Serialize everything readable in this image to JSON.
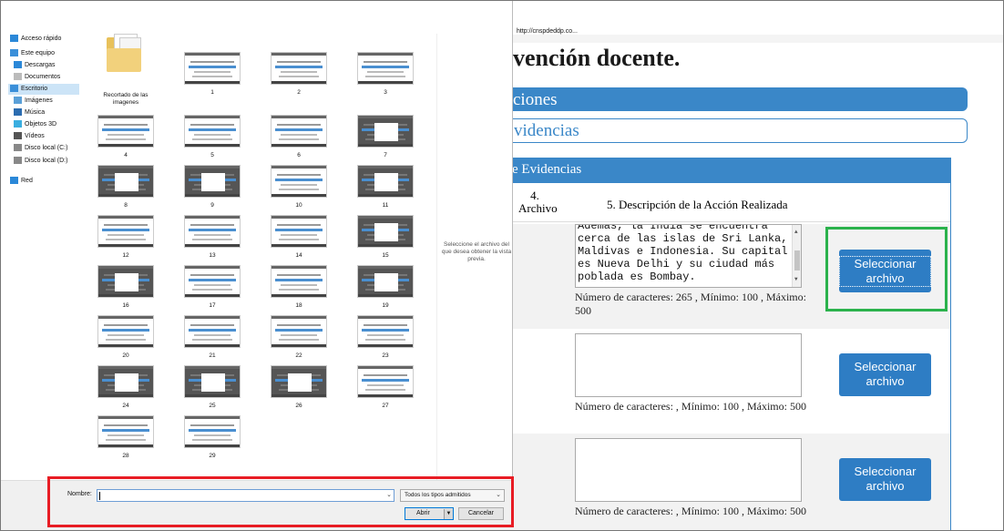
{
  "browser": {
    "url": "http://cnspdeddp.co...",
    "heading": "vención docente.",
    "bar_solid": "ciones",
    "bar_outline": "videncias",
    "table": {
      "title": "e Evidencias",
      "col4_line1": "4.",
      "col4_line2": "Archivo",
      "col5": "5. Descripción de la Acción Realizada",
      "rows": [
        {
          "text_lines": [
            "Además, la India se encuentra",
            "cerca de las islas de Sri Lanka,",
            "Maldivas e Indonesia. Su capital",
            "es Nueva Delhi y su ciudad más",
            "poblada es Bombay."
          ],
          "count": "Número de caracteres: 265 , Mínimo: 100 , Máximo: 500",
          "button": "Seleccionar archivo"
        },
        {
          "text_lines": [],
          "count": "Número de caracteres: , Mínimo: 100 , Máximo: 500",
          "button": "Seleccionar archivo"
        },
        {
          "text_lines": [],
          "count": "Número de caracteres: , Mínimo: 100 , Máximo: 500",
          "button": "Seleccionar archivo"
        }
      ]
    }
  },
  "dialog": {
    "nav": [
      {
        "label": "Acceso rápido",
        "icon": "star-icon",
        "color": "#2b88d8"
      },
      {
        "label": "Este equipo",
        "icon": "computer-icon",
        "color": "#3a8fd9"
      },
      {
        "label": "Descargas",
        "icon": "download-icon",
        "color": "#2b88d8"
      },
      {
        "label": "Documentos",
        "icon": "document-icon",
        "color": "#bbbbbb"
      },
      {
        "label": "Escritorio",
        "icon": "desktop-icon",
        "color": "#3a8fd9"
      },
      {
        "label": "Imágenes",
        "icon": "image-icon",
        "color": "#5aa0d8"
      },
      {
        "label": "Música",
        "icon": "music-icon",
        "color": "#2b6cb0"
      },
      {
        "label": "Objetos 3D",
        "icon": "cube-icon",
        "color": "#3aaee0"
      },
      {
        "label": "Vídeos",
        "icon": "video-icon",
        "color": "#555555"
      },
      {
        "label": "Disco local (C:)",
        "icon": "drive-icon",
        "color": "#888888"
      },
      {
        "label": "Disco local (D:)",
        "icon": "drive-icon",
        "color": "#888888"
      },
      {
        "label": "Red",
        "icon": "network-icon",
        "color": "#2b88d8"
      }
    ],
    "files": [
      {
        "label": "Recortado de las imagenes",
        "kind": "folder"
      },
      {
        "label": "1",
        "kind": "light"
      },
      {
        "label": "2",
        "kind": "light"
      },
      {
        "label": "3",
        "kind": "light"
      },
      {
        "label": "4",
        "kind": "light"
      },
      {
        "label": "5",
        "kind": "light"
      },
      {
        "label": "6",
        "kind": "light"
      },
      {
        "label": "7",
        "kind": "dark"
      },
      {
        "label": "8",
        "kind": "dark"
      },
      {
        "label": "9",
        "kind": "dark"
      },
      {
        "label": "10",
        "kind": "light"
      },
      {
        "label": "11",
        "kind": "dark"
      },
      {
        "label": "12",
        "kind": "light"
      },
      {
        "label": "13",
        "kind": "light"
      },
      {
        "label": "14",
        "kind": "light"
      },
      {
        "label": "15",
        "kind": "dark"
      },
      {
        "label": "16",
        "kind": "dark"
      },
      {
        "label": "17",
        "kind": "light"
      },
      {
        "label": "18",
        "kind": "light"
      },
      {
        "label": "19",
        "kind": "dark"
      },
      {
        "label": "20",
        "kind": "light"
      },
      {
        "label": "21",
        "kind": "light"
      },
      {
        "label": "22",
        "kind": "light"
      },
      {
        "label": "23",
        "kind": "light"
      },
      {
        "label": "24",
        "kind": "dark"
      },
      {
        "label": "25",
        "kind": "dark"
      },
      {
        "label": "26",
        "kind": "dark"
      },
      {
        "label": "27",
        "kind": "light"
      },
      {
        "label": "28",
        "kind": "light"
      },
      {
        "label": "29",
        "kind": "light"
      }
    ],
    "preview_text": "Seleccione el archivo del que desea obtener la vista previa.",
    "filename_label": "Nombre:",
    "filename_value": "",
    "filetype": "Todos los tipos admitidos",
    "open_button": "Abrir",
    "cancel_button": "Cancelar"
  },
  "colors": {
    "accent_blue": "#3a87c8",
    "button_blue": "#2e7dc4",
    "highlight_green": "#2bb24c",
    "highlight_red": "#e81c24"
  }
}
